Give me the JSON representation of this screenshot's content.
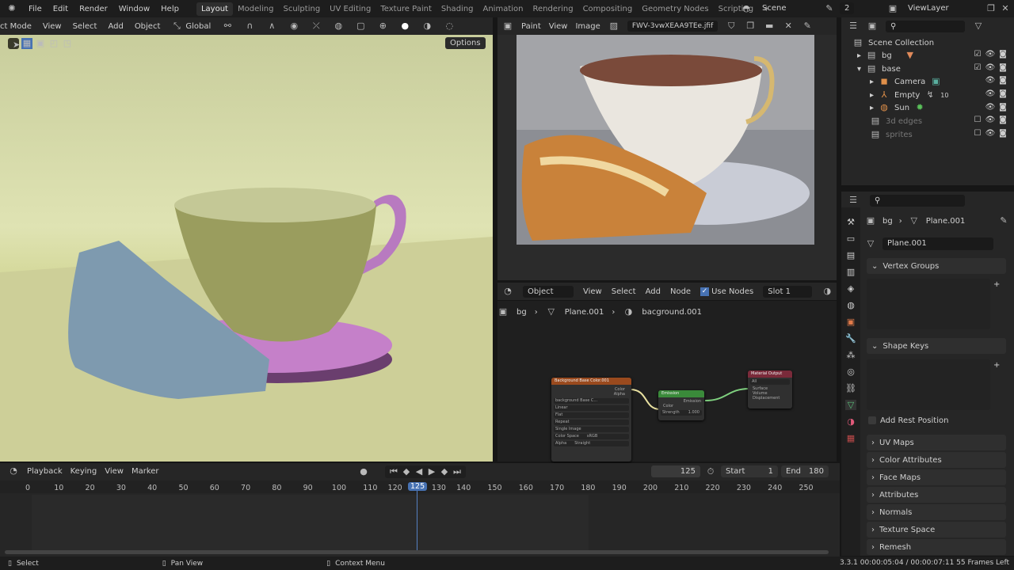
{
  "topbar": {
    "menus": [
      "File",
      "Edit",
      "Render",
      "Window",
      "Help"
    ],
    "workspaces": [
      "Layout",
      "Modeling",
      "Sculpting",
      "UV Editing",
      "Texture Paint",
      "Shading",
      "Animation",
      "Rendering",
      "Compositing",
      "Geometry Nodes",
      "Scripting"
    ],
    "active_workspace": "Layout",
    "scene": "Scene",
    "viewlayer": "ViewLayer",
    "users": "2"
  },
  "viewport": {
    "mode": "ct Mode",
    "menus": [
      "View",
      "Select",
      "Add",
      "Object"
    ],
    "orientation": "Global",
    "options": "Options"
  },
  "image_editor": {
    "mode": "Paint",
    "menus": [
      "View",
      "Image"
    ],
    "image_name": "FWV-3vwXEAA9TEe.jfif"
  },
  "node_editor": {
    "type": "Object",
    "menus": [
      "View",
      "Select",
      "Add",
      "Node"
    ],
    "use_nodes": "Use Nodes",
    "slot": "Slot 1",
    "breadcrumb": [
      "bg",
      "Plane.001",
      "bacground.001"
    ],
    "nodes": {
      "image": {
        "title": "Background Base Color.001",
        "out": [
          "Color",
          "Alpha"
        ],
        "img": "background Base C...",
        "fields": [
          "Linear",
          "Flat",
          "Repeat",
          "Single Image"
        ],
        "cs_label": "Color Space",
        "cs_val": "sRGB",
        "alpha_label": "Alpha",
        "alpha_val": "Straight"
      },
      "emission": {
        "title": "Emission",
        "out": "Emission",
        "in": "Color",
        "strength": "Strength",
        "strength_val": "1.000"
      },
      "output": {
        "title": "Material Output",
        "target": "All",
        "in": [
          "Surface",
          "Volume",
          "Displacement"
        ]
      }
    }
  },
  "outliner": {
    "root": "Scene Collection",
    "items": [
      {
        "name": "bg",
        "level": 1,
        "checked": true
      },
      {
        "name": "base",
        "level": 1,
        "checked": true
      },
      {
        "name": "Camera",
        "level": 2
      },
      {
        "name": "Empty",
        "level": 2,
        "badge": "10"
      },
      {
        "name": "Sun",
        "level": 2
      },
      {
        "name": "3d edges",
        "level": 1,
        "checked": false,
        "dim": true
      },
      {
        "name": "sprites",
        "level": 1,
        "checked": false,
        "dim": true
      }
    ]
  },
  "properties": {
    "breadcrumb": [
      "bg",
      "Plane.001"
    ],
    "mesh_name": "Plane.001",
    "panels": {
      "vertex_groups": "Vertex Groups",
      "shape_keys": "Shape Keys",
      "add_rest": "Add Rest Position"
    },
    "collapsed": [
      "UV Maps",
      "Color Attributes",
      "Face Maps",
      "Attributes",
      "Normals",
      "Texture Space",
      "Remesh"
    ]
  },
  "timeline": {
    "menus": [
      "Playback",
      "Keying",
      "View",
      "Marker"
    ],
    "current_frame": "125",
    "start_label": "Start",
    "start": "1",
    "end_label": "End",
    "end": "180",
    "ticks": [
      "0",
      "10",
      "20",
      "30",
      "40",
      "50",
      "60",
      "70",
      "80",
      "90",
      "100",
      "110",
      "120",
      "130",
      "140",
      "150",
      "160",
      "170",
      "180",
      "190",
      "200",
      "210",
      "220",
      "230",
      "240",
      "250"
    ]
  },
  "status": {
    "select": "Select",
    "pan": "Pan View",
    "context": "Context Menu",
    "info": "3.3.1  00:00:05:04 / 00:00:07:11  55 Frames Left"
  },
  "colors": {
    "accent": "#4772b3",
    "frame_line": "#5680c2"
  }
}
